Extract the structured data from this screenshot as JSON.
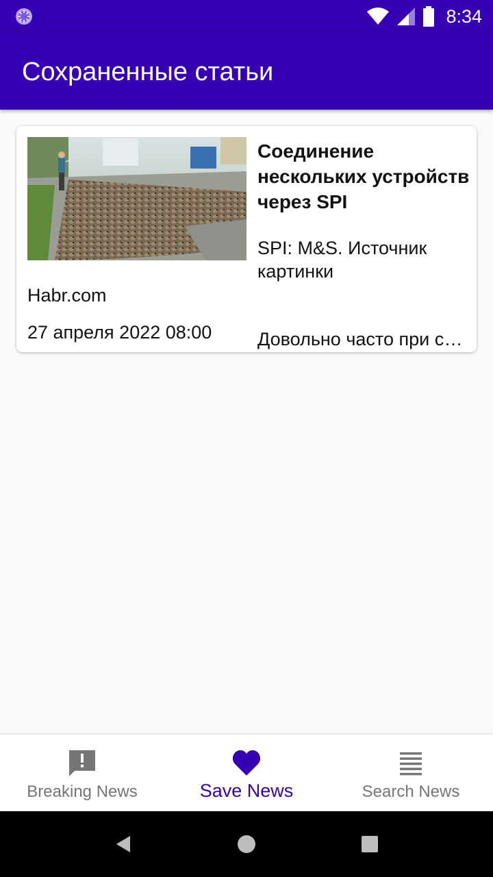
{
  "status_bar": {
    "time": "8:34",
    "icons": [
      "loading-circle-icon",
      "wifi-icon",
      "cellular-signal-icon",
      "battery-icon"
    ]
  },
  "app_bar": {
    "title": "Сохраненные статьи"
  },
  "articles": [
    {
      "image": "ducks-photo",
      "title": "Соединение нескольких устройств через SPI",
      "subtitle": "SPI: M&S. Источник картинки",
      "source": "Habr.com",
      "date": "27 апреля 2022 08:00",
      "description": "Довольно часто при создании"
    }
  ],
  "bottom_nav": {
    "items": [
      {
        "label": "Breaking News",
        "icon": "alert-message-icon",
        "active": false
      },
      {
        "label": "Save News",
        "icon": "heart-icon",
        "active": true
      },
      {
        "label": "Search News",
        "icon": "list-lines-icon",
        "active": false
      }
    ]
  },
  "colors": {
    "primary": "#3700b3",
    "inactive": "#757575",
    "background": "#fafafa"
  },
  "system_nav": {
    "buttons": [
      "back-icon",
      "home-icon",
      "recents-icon"
    ]
  }
}
